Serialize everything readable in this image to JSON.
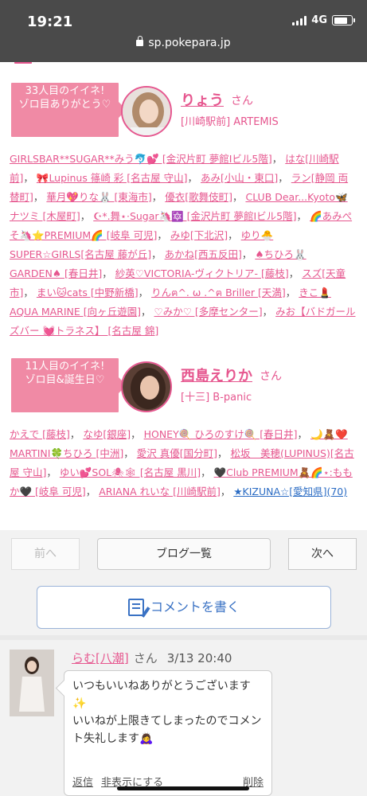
{
  "status": {
    "time": "19:21",
    "network": "4G"
  },
  "browser": {
    "url": "sp.pokepara.jp"
  },
  "events": [
    {
      "badge": "33人目のイイネ!\nゾロ目ありがとう♡",
      "name": "りょう",
      "san": "さん",
      "shop": "[川崎駅前] ARTEMIS"
    },
    {
      "badge": "11人目のイイネ!\nゾロ目&誕生日♡",
      "name": "西島えりか",
      "san": "さん",
      "shop": "[十三] B-panic"
    }
  ],
  "links1": [
    "GIRLSBAR**SUGAR**みう🐬💕 [金沢片町 夢館Ⅰビル5階]",
    "はな[川崎駅前]",
    "🎀Lupinus 篠崎 彩 [名古屋 守山]",
    "あみ[小山・東口]",
    "ラン[静岡 両替町]",
    "華月💖りな🐰 [東海市]",
    "優衣[歌舞伎町]",
    "CLUB Dear...Kyoto🦋ナツミ [木屋町]",
    "☪︎*.舞⋆·Sugar🦄🔯 [金沢片町 夢館Ⅰビル5階]",
    "🌈あみぺそ🦄⭐PREMIUM🌈 [岐阜 可児]",
    "みゆ[下北沢]",
    "ゆり🐣SUPER☆GIRLS[名古屋 藤が丘]",
    "あかね[西五反田]",
    "♠ちひろ🐰GARDEN♠ [春日井]",
    "紗英♡VICTORIA-ヴィクトリア- [藤枝]",
    "スズ[天童市]",
    "まい🐱cats [中野新橋]",
    "りんฅ^. ω .^ฅ Briller [天満]",
    "きこ💄AQUA MARINE [向ヶ丘遊園]",
    "♡みか♡ [多摩センター]",
    "みお【バドガールズバー 💓トラネス】 [名古屋 錦]"
  ],
  "links2": [
    "かえで [藤枝]",
    "なゆ[銀座]",
    "HONEY🍭 ひろのすけ🍭 [春日井]",
    "🌙🧸❤️MARTINI🍀ちひろ [中洲]",
    "愛沢 真優[国分町]",
    "松坂　美穂(LUPINUS)[名古屋 守山]",
    "ゆい💕SOL🕷🕸 [名古屋 黒川]",
    "🖤Club PREMIUM🧸🌈⋆:ももか🖤 [岐阜 可児]",
    "ARIANA れいな [川崎駅前]",
    "★KIZUNA☆[愛知県](70)"
  ],
  "pager": {
    "prev": "前へ",
    "list": "ブログ一覧",
    "next": "次へ"
  },
  "comment_button": "コメントを書く",
  "comment": {
    "name": "らむ[八潮]",
    "san": "さん",
    "time": "3/13 20:40",
    "text": "いつもいいねありがとうございます✨\nいいねが上限きてしまったのでコメント失礼します🙇‍♀️",
    "reply": "返信",
    "hide": "非表示にする",
    "delete": "削除"
  }
}
